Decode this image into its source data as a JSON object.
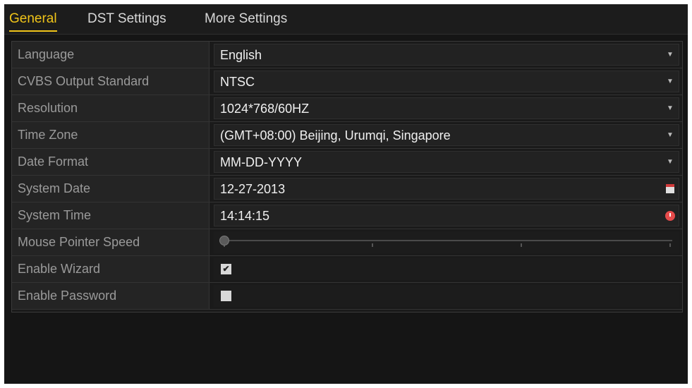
{
  "tabs": [
    {
      "label": "General",
      "active": true
    },
    {
      "label": "DST Settings",
      "active": false
    },
    {
      "label": "More Settings",
      "active": false
    }
  ],
  "settings": {
    "language": {
      "label": "Language",
      "value": "English",
      "icon": "chevron-down-icon"
    },
    "cvbs": {
      "label": "CVBS Output Standard",
      "value": "NTSC",
      "icon": "chevron-down-icon"
    },
    "resolution": {
      "label": "Resolution",
      "value": "1024*768/60HZ",
      "icon": "chevron-down-icon"
    },
    "timezone": {
      "label": "Time Zone",
      "value": "(GMT+08:00) Beijing, Urumqi, Singapore",
      "icon": "chevron-down-icon"
    },
    "date_format": {
      "label": "Date Format",
      "value": "MM-DD-YYYY",
      "icon": "chevron-down-icon"
    },
    "system_date": {
      "label": "System Date",
      "value": "12-27-2013",
      "icon": "calendar-icon"
    },
    "system_time": {
      "label": "System Time",
      "value": "14:14:15",
      "icon": "clock-icon"
    },
    "mouse_speed": {
      "label": "Mouse Pointer Speed",
      "level": 0
    },
    "enable_wizard": {
      "label": "Enable Wizard",
      "checked": true
    },
    "enable_password": {
      "label": "Enable Password",
      "checked": false
    }
  },
  "colors": {
    "accent": "#f0c419",
    "background": "#151515",
    "label_text": "#9a9a9a",
    "value_text": "#f0f0f0",
    "calendar_icon": "#d23a3a",
    "clock_icon": "#e64b4b"
  }
}
